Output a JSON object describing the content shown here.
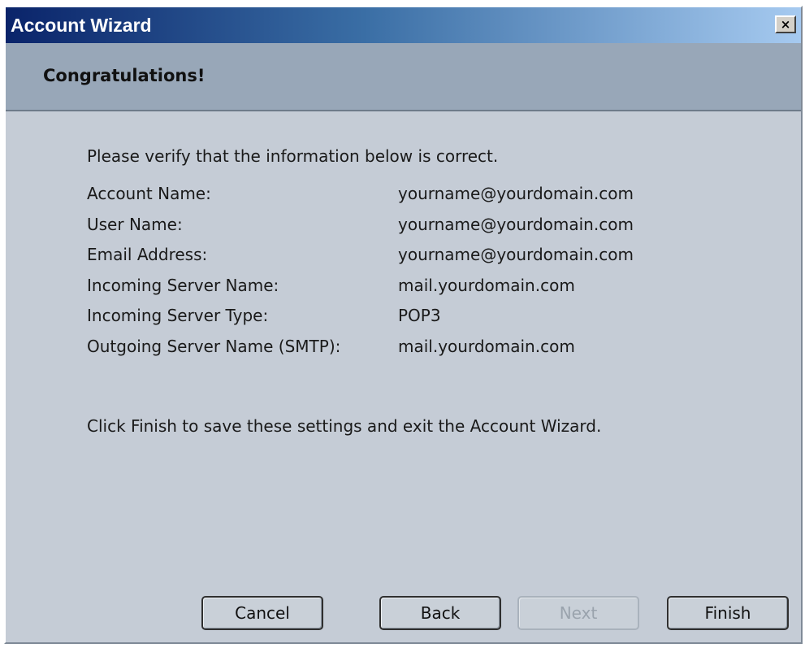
{
  "window": {
    "title": "Account Wizard",
    "close_label": "×"
  },
  "header": {
    "title": "Congratulations!"
  },
  "content": {
    "intro": "Please verify that the information below is correct.",
    "rows": [
      {
        "label": "Account Name:",
        "value": "yourname@yourdomain.com"
      },
      {
        "label": "User Name:",
        "value": "yourname@yourdomain.com"
      },
      {
        "label": "Email Address:",
        "value": "yourname@yourdomain.com"
      },
      {
        "label": "Incoming Server Name:",
        "value": "mail.yourdomain.com"
      },
      {
        "label": "Incoming Server Type:",
        "value": "POP3"
      },
      {
        "label": "Outgoing Server Name (SMTP):",
        "value": "mail.yourdomain.com"
      }
    ],
    "footer": "Click Finish to save these settings and exit the Account Wizard."
  },
  "buttons": {
    "cancel": "Cancel",
    "back": "Back",
    "next": "Next",
    "finish": "Finish"
  },
  "colors": {
    "titlebar_start": "#0a246a",
    "titlebar_end": "#a6caf0",
    "header_band": "#98a7b8",
    "body": "#c5ccd6"
  }
}
